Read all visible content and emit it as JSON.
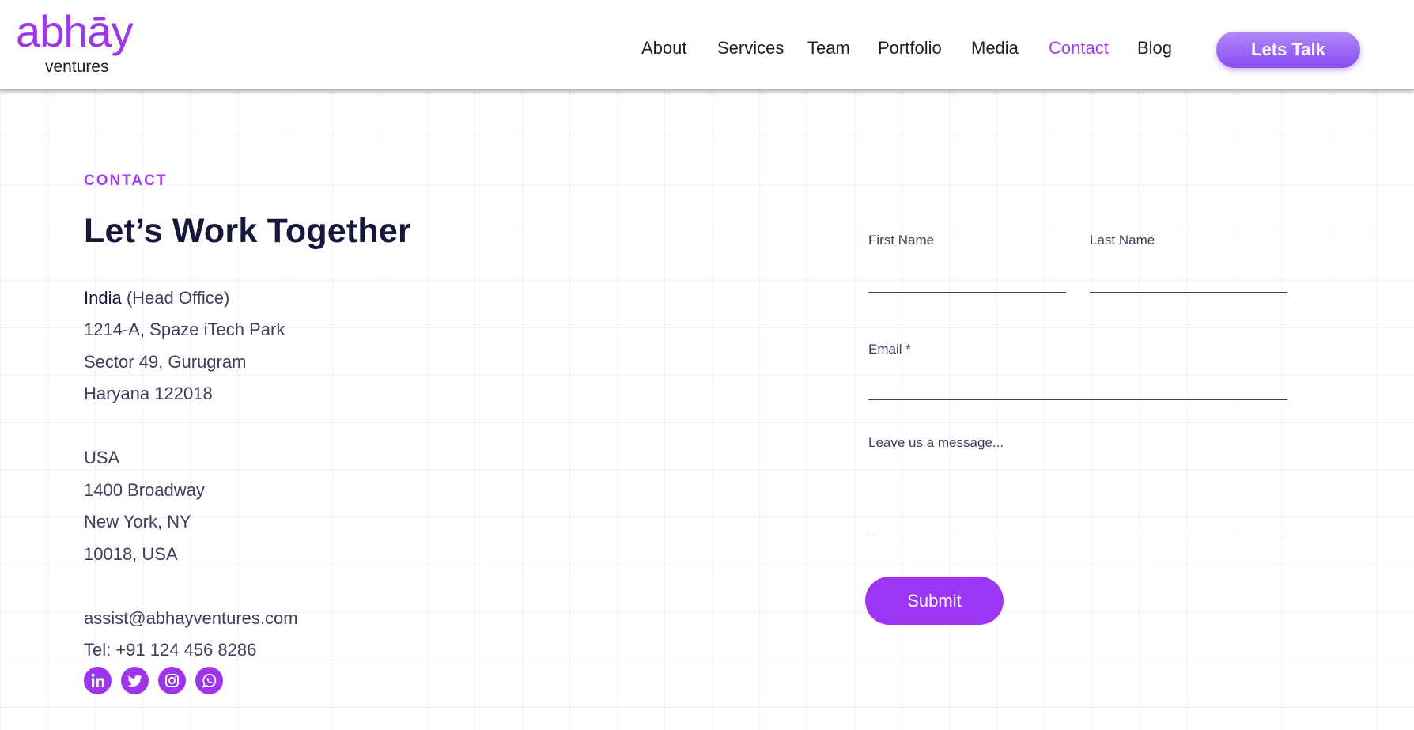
{
  "header": {
    "logo_main": "abhāy",
    "logo_sub": "ventures",
    "nav": [
      {
        "label": "About",
        "active": false
      },
      {
        "label": "Services",
        "active": false
      },
      {
        "label": "Team",
        "active": false
      },
      {
        "label": "Portfolio",
        "active": false
      },
      {
        "label": "Media",
        "active": false
      },
      {
        "label": "Contact",
        "active": true
      },
      {
        "label": "Blog",
        "active": false
      }
    ],
    "cta_label": "Lets Talk"
  },
  "contact": {
    "eyebrow": "CONTACT",
    "headline": "Let’s Work Together",
    "india": {
      "country": "India",
      "note": "(Head Office)",
      "lines": [
        "1214-A, Spaze iTech Park",
        "Sector 49, Gurugram",
        "Haryana 122018"
      ]
    },
    "usa": {
      "country": "USA",
      "lines": [
        "1400 Broadway",
        "New York, NY",
        "10018, USA"
      ]
    },
    "email": "assist@abhayventures.com",
    "phone": "Tel: +91 124 456 8286",
    "socials": [
      "linkedin-icon",
      "twitter-icon",
      "instagram-icon",
      "whatsapp-icon"
    ]
  },
  "form": {
    "first_name_label": "First Name",
    "last_name_label": "Last Name",
    "email_label": "Email *",
    "message_label": "Leave us a message...",
    "first_name_value": "",
    "last_name_value": "",
    "email_value": "",
    "message_value": "",
    "submit_label": "Submit"
  },
  "colors": {
    "accent": "#9d35e8",
    "heading": "#17163b",
    "body_text": "#3e3d5c"
  }
}
